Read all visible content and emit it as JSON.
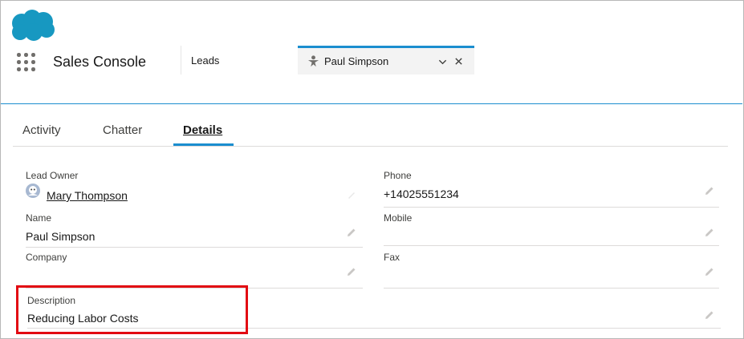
{
  "header": {
    "app_name": "Sales Console",
    "tabs": [
      {
        "label": "Leads"
      },
      {
        "label": "Paul Simpson"
      }
    ]
  },
  "record_tabs": [
    "Activity",
    "Chatter",
    "Details"
  ],
  "active_record_tab": "Details",
  "fields": {
    "lead_owner": {
      "label": "Lead Owner",
      "value": "Mary Thompson"
    },
    "phone": {
      "label": "Phone",
      "value": "+14025551234"
    },
    "name": {
      "label": "Name",
      "value": "Paul Simpson"
    },
    "mobile": {
      "label": "Mobile",
      "value": ""
    },
    "company": {
      "label": "Company",
      "value": ""
    },
    "fax": {
      "label": "Fax",
      "value": ""
    },
    "description": {
      "label": "Description",
      "value": "Reducing Labor Costs"
    }
  },
  "colors": {
    "brand": "#1b8ecf",
    "link": "#0b6fb8",
    "highlight": "#e20a12"
  },
  "icons": [
    "salesforce-cloud-logo",
    "app-launcher-icon",
    "lead-icon",
    "chevron-down-icon",
    "close-icon",
    "user-avatar-icon",
    "pencil-icon"
  ]
}
